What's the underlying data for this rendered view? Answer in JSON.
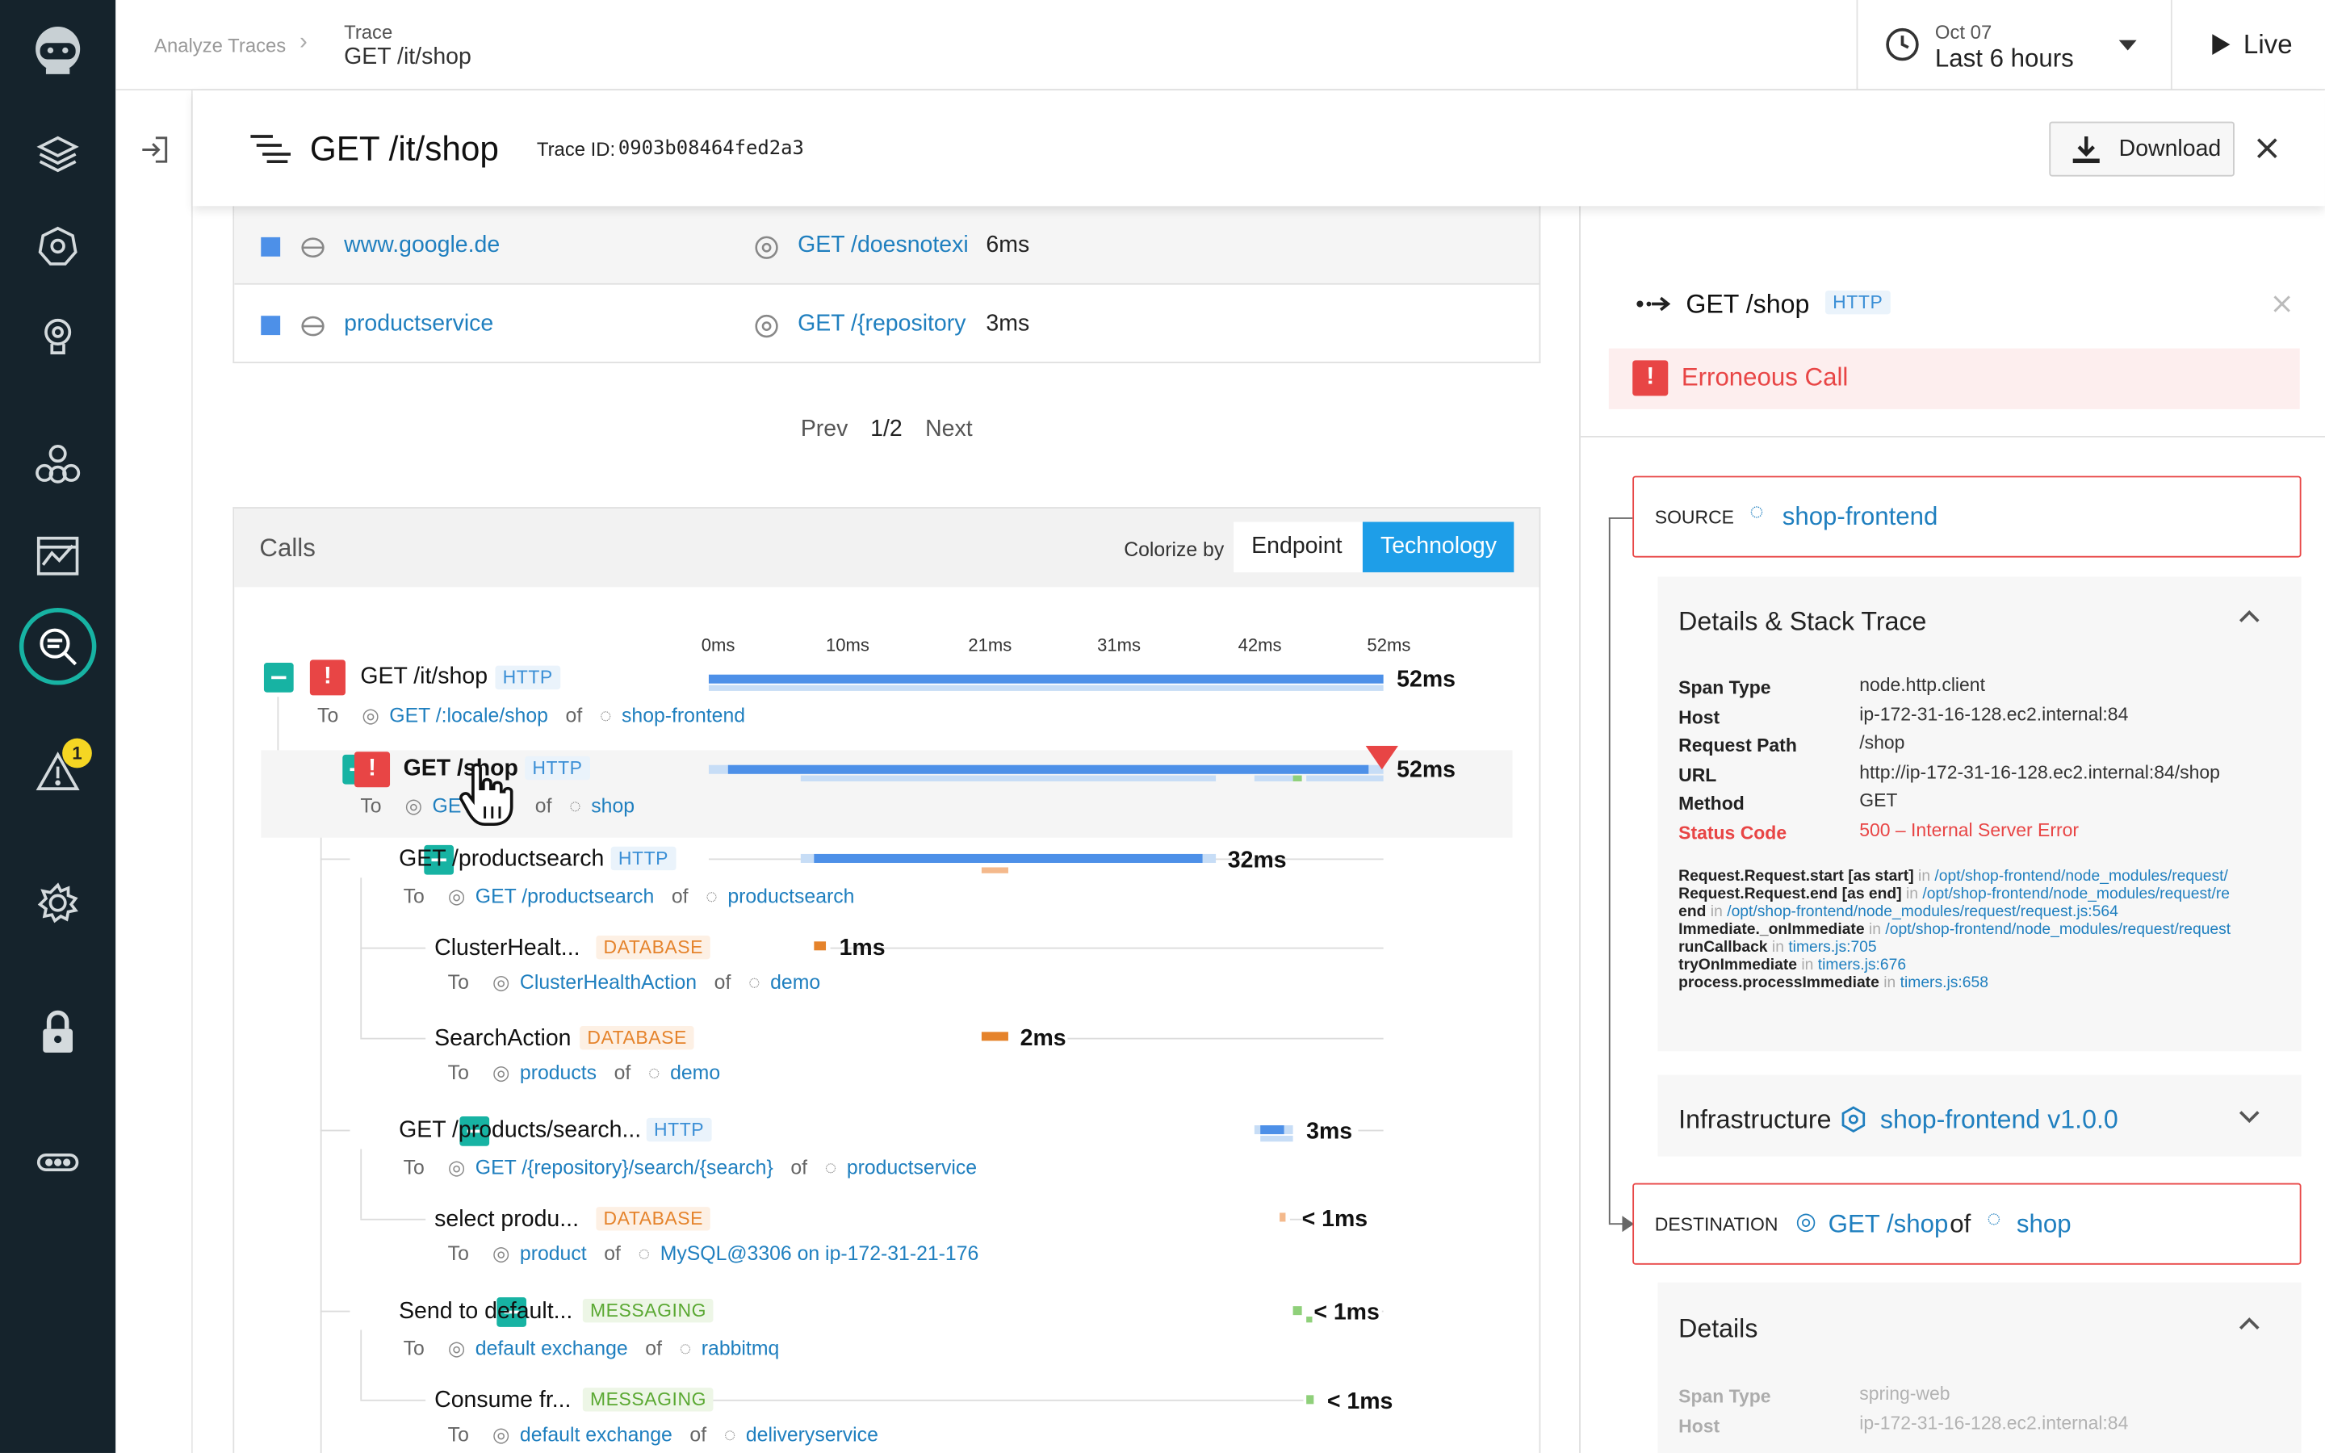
{
  "header": {
    "breadcrumb_root": "Analyze Traces",
    "breadcrumb_label": "Trace",
    "breadcrumb_value": "GET /it/shop",
    "date": "Oct 07",
    "range": "Last 6 hours",
    "live": "Live"
  },
  "trace": {
    "title": "GET /it/shop",
    "id_label": "Trace ID:",
    "id": "0903b08464fed2a3",
    "download": "Download"
  },
  "services_table": {
    "rows": [
      {
        "service": "www.google.de",
        "endpoint": "GET /doesnotexi",
        "time": "6ms"
      },
      {
        "service": "productservice",
        "endpoint": "GET /{repository",
        "time": "3ms"
      }
    ]
  },
  "pager": {
    "prev": "Prev",
    "page": "1/2",
    "next": "Next"
  },
  "calls": {
    "title": "Calls",
    "colorize_label": "Colorize by",
    "options": [
      "Endpoint",
      "Technology"
    ],
    "selected": "Technology",
    "ticks": [
      "0ms",
      "10ms",
      "21ms",
      "31ms",
      "42ms",
      "52ms"
    ],
    "rows": [
      {
        "name": "GET /it/shop",
        "tech": "HTTP",
        "to": "To",
        "endpoint": "GET /:locale/shop",
        "of": "of",
        "service": "shop-frontend",
        "duration": "52ms"
      },
      {
        "name": "GET /shop",
        "tech": "HTTP",
        "to": "To",
        "endpoint": "GET",
        "of": "of",
        "service": "shop",
        "duration": "52ms"
      },
      {
        "name": "GET /productsearch",
        "tech": "HTTP",
        "to": "To",
        "endpoint": "GET /productsearch",
        "of": "of",
        "service": "productsearch",
        "duration": "32ms"
      },
      {
        "name": "ClusterHealt...",
        "tech": "DATABASE",
        "to": "To",
        "endpoint": "ClusterHealthAction",
        "of": "of",
        "service": "demo",
        "duration": "1ms"
      },
      {
        "name": "SearchAction",
        "tech": "DATABASE",
        "to": "To",
        "endpoint": "products",
        "of": "of",
        "service": "demo",
        "duration": "2ms"
      },
      {
        "name": "GET /products/search...",
        "tech": "HTTP",
        "to": "To",
        "endpoint": "GET /{repository}/search/{search}",
        "of": "of",
        "service": "productservice",
        "duration": "3ms"
      },
      {
        "name": "select produ...",
        "tech": "DATABASE",
        "to": "To",
        "endpoint": "product",
        "of": "of",
        "service": "MySQL@3306 on ip-172-31-21-176",
        "duration": "< 1ms"
      },
      {
        "name": "Send to default...",
        "tech": "MESSAGING",
        "to": "To",
        "endpoint": "default exchange",
        "of": "of",
        "service": "rabbitmq",
        "duration": "< 1ms"
      },
      {
        "name": "Consume fr...",
        "tech": "MESSAGING",
        "to": "To",
        "endpoint": "default exchange",
        "of": "of",
        "service": "deliveryservice",
        "duration": "< 1ms"
      }
    ]
  },
  "detail": {
    "title": "GET /shop",
    "tech": "HTTP",
    "error": "Erroneous Call",
    "source_label": "SOURCE",
    "source": "shop-frontend",
    "details_title": "Details & Stack Trace",
    "kv": [
      {
        "k": "Span Type",
        "v": "node.http.client"
      },
      {
        "k": "Host",
        "v": "ip-172-31-16-128.ec2.internal:84"
      },
      {
        "k": "Request Path",
        "v": "/shop"
      },
      {
        "k": "URL",
        "v": "http://ip-172-31-16-128.ec2.internal:84/shop"
      },
      {
        "k": "Method",
        "v": "GET"
      },
      {
        "k": "Status Code",
        "v": "500 – Internal Server Error"
      }
    ],
    "stack": [
      {
        "fn": "Request.Request.start [as start]",
        "in": "in",
        "path": "/opt/shop-frontend/node_modules/request/"
      },
      {
        "fn": "Request.Request.end [as end]",
        "in": "in",
        "path": "/opt/shop-frontend/node_modules/request/re"
      },
      {
        "fn": "end",
        "in": "in",
        "path": "/opt/shop-frontend/node_modules/request/request.js:564"
      },
      {
        "fn": "Immediate._onImmediate",
        "in": "in",
        "path": "/opt/shop-frontend/node_modules/request/request"
      },
      {
        "fn": "runCallback",
        "in": "in",
        "path": "timers.js:705"
      },
      {
        "fn": "tryOnImmediate",
        "in": "in",
        "path": "timers.js:676"
      },
      {
        "fn": "process.processImmediate",
        "in": "in",
        "path": "timers.js:658"
      }
    ],
    "infra_label": "Infrastructure",
    "infra_value": "shop-frontend v1.0.0",
    "dest_label": "DESTINATION",
    "dest_endpoint": "GET /shop",
    "dest_of": "of",
    "dest_service": "shop",
    "details2_title": "Details",
    "kv2": [
      {
        "k": "Span Type",
        "v": "spring-web"
      },
      {
        "k": "Host",
        "v": "ip-172-31-16-128.ec2.internal:84"
      }
    ]
  },
  "sidebar": {
    "badge": "1"
  },
  "colors": {
    "sidebar": "#15232c",
    "accent": "#17b3a3",
    "link": "#1f7fbf",
    "error": "#e84545",
    "bar": "#4d90e8"
  }
}
